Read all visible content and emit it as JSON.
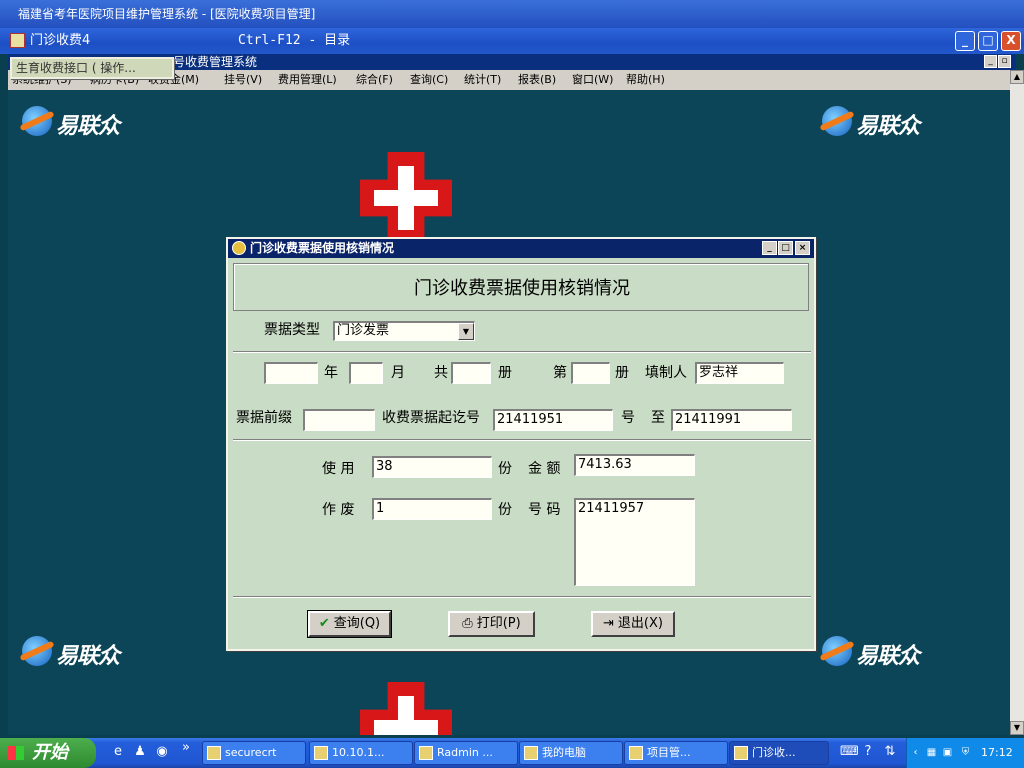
{
  "bg_window": {
    "title": "福建省考年医院项目维护管理系统 - [医院收费项目管理]"
  },
  "main_window": {
    "title": "门诊收费4",
    "subtitle": "Ctrl-F12 - 目录",
    "inner_title": "号收费管理系统",
    "popup_label": "生育收费接口 ( 操作...",
    "min_label": "_",
    "max_label": "□",
    "close_label": "X"
  },
  "menu": {
    "items": [
      "系统维护(S)",
      "病历卡(B)",
      "收费金(M)",
      "挂号(V)",
      "费用管理(L)",
      "综合(F)",
      "查询(C)",
      "统计(T)",
      "报表(B)",
      "窗口(W)",
      "帮助(H)"
    ]
  },
  "brand": {
    "logo_text": "易联众"
  },
  "dialog": {
    "title": "门诊收费票据使用核销情况",
    "heading": "门诊收费票据使用核销情况",
    "ticket_type_label": "票据类型",
    "ticket_type_value": "门诊发票",
    "year_label": "年",
    "month_label": "月",
    "total_label": "共",
    "volume_label": "册",
    "nth_label": "第",
    "volume2_label": "册",
    "preparer_label": "填制人",
    "preparer_value": "罗志祥",
    "year_value": "",
    "month_value": "",
    "total_value": "",
    "nth_value": "",
    "prefix_label": "票据前缀",
    "prefix_value": "",
    "start_no_label": "收费票据起讫号",
    "start_no_value": "21411951",
    "hao_label": "号",
    "to_label": "至",
    "end_no_value": "21411991",
    "used_label": "使  用",
    "used_value": "38",
    "fen_label": "份",
    "amount_label": "金  额",
    "amount_value": "7413.63",
    "void_label": "作  废",
    "void_value": "1",
    "fen2_label": "份",
    "number_label": "号  码",
    "number_value": "21411957",
    "btn_query": "查询(Q)",
    "btn_print": "打印(P)",
    "btn_exit": "退出(X)"
  },
  "taskbar": {
    "start_label": "开始",
    "tasks": [
      "securecrt",
      "10.10.1...",
      "Radmin ...",
      "我的电脑",
      "项目管...",
      "门诊收..."
    ],
    "clock": "17:12"
  },
  "colors": {
    "desktop": "#0b4557",
    "dialog_bg": "#c9dcc5",
    "titlebar": "#0a246a"
  }
}
